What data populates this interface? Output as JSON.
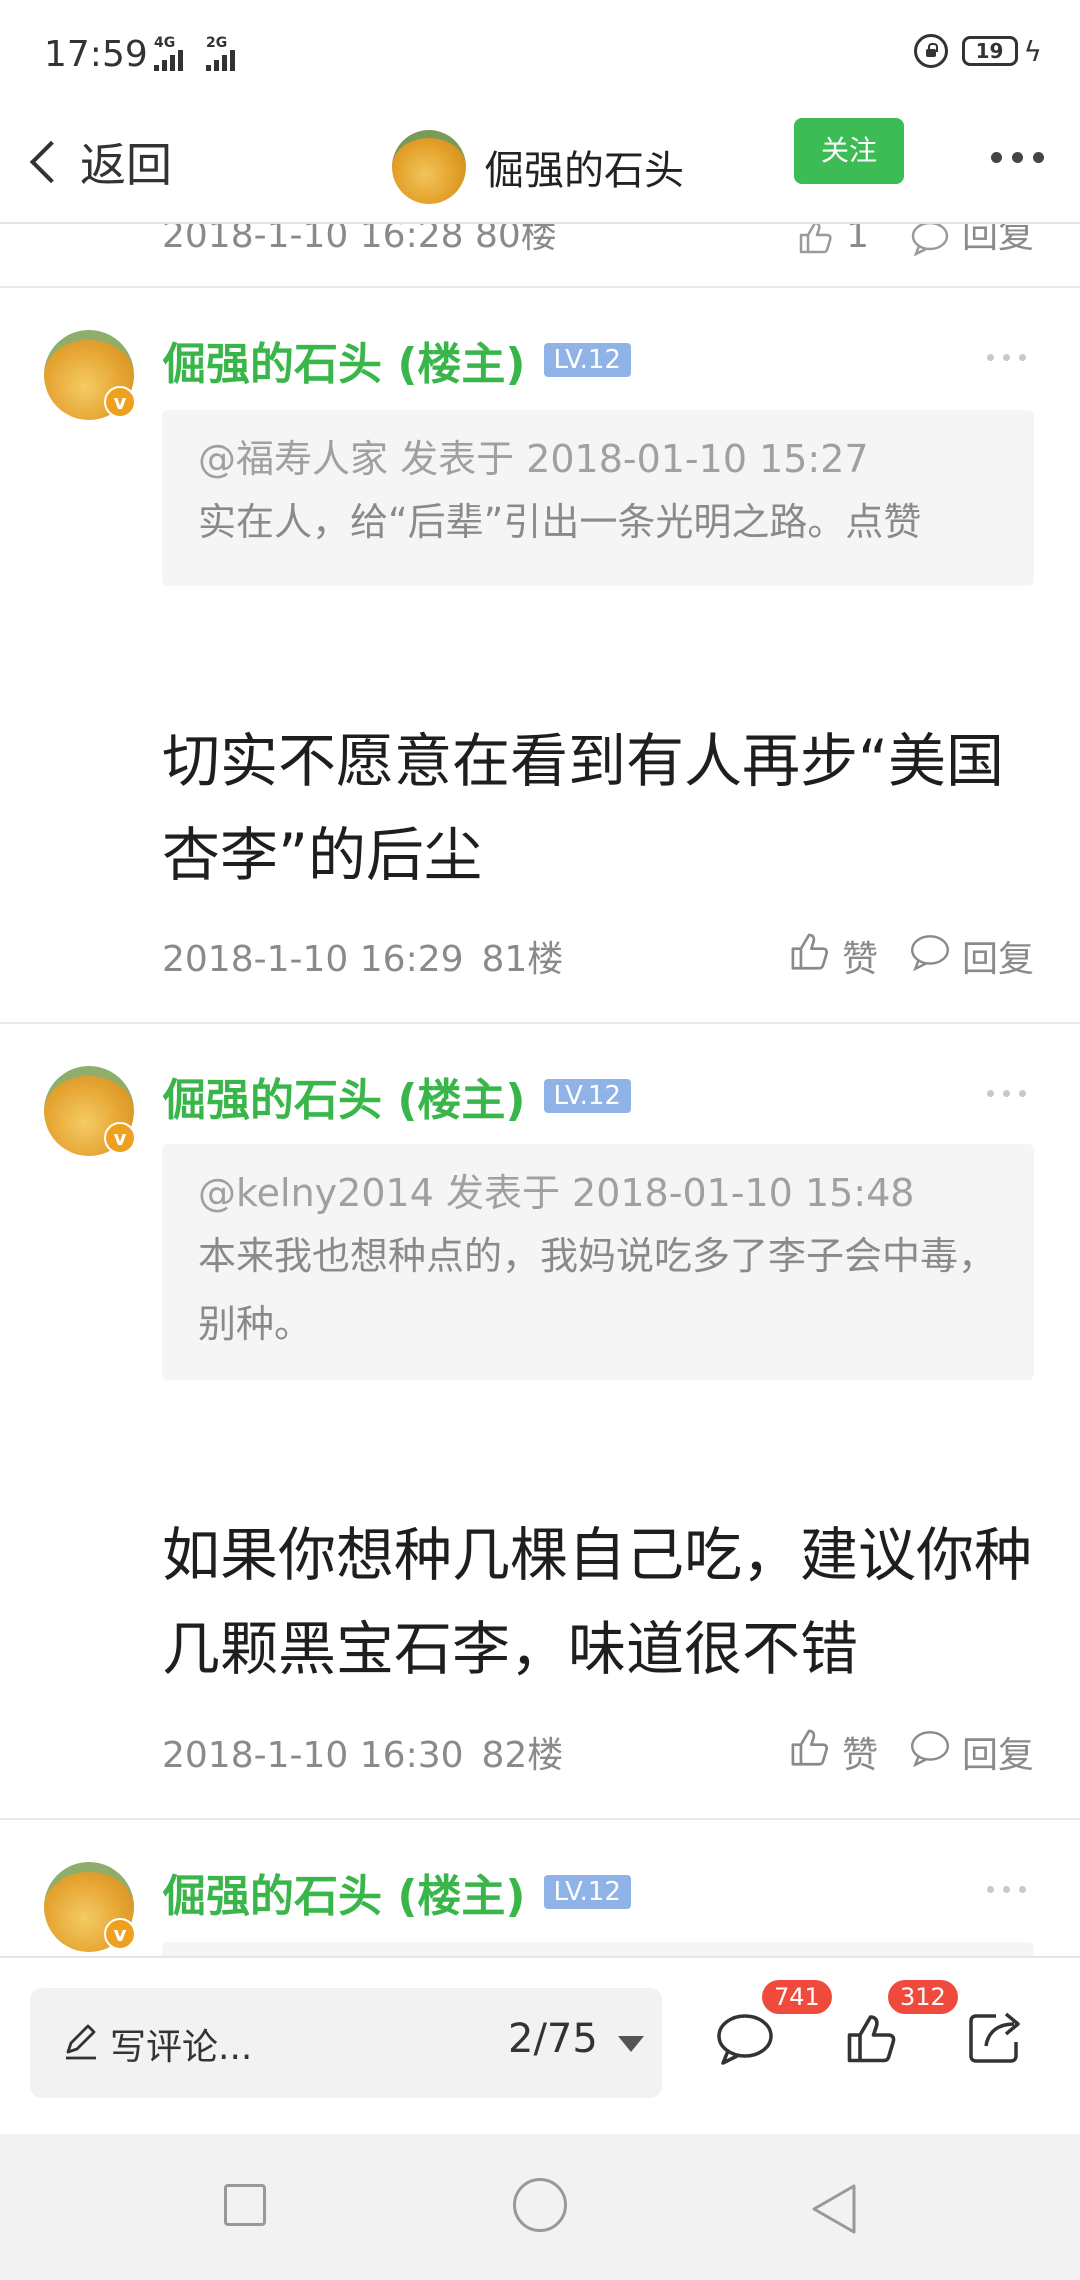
{
  "status_bar": {
    "time": "17:59",
    "network_1": "4G",
    "network_2": "2G",
    "battery": "19"
  },
  "nav": {
    "back_label": "返回",
    "title": "倔强的石头",
    "follow_label": "关注"
  },
  "partial_post": {
    "meta": "2018-1-10 16:28  80楼",
    "like_count": "1",
    "reply_label": "回复"
  },
  "posts": [
    {
      "author": "倔强的石头 (楼主)",
      "level": "LV.12",
      "quote_head": "@福寿人家 发表于 2018-01-10 15:27",
      "quote_text": "实在人，给“后辈”引出一条光明之路。点赞",
      "body": "切实不愿意在看到有人再步“美国杏李”的后尘",
      "date": "2018-1-10 16:29",
      "floor": "81楼",
      "like_label": "赞",
      "reply_label": "回复"
    },
    {
      "author": "倔强的石头 (楼主)",
      "level": "LV.12",
      "quote_head": "@kelny2014 发表于 2018-01-10 15:48",
      "quote_text": "本来我也想种点的，我妈说吃多了李子会中毒，别种。",
      "body": "如果你想种几棵自己吃，建议你种几颗黑宝石李，味道很不错",
      "date": "2018-1-10 16:30",
      "floor": "82楼",
      "like_label": "赞",
      "reply_label": "回复"
    },
    {
      "author": "倔强的石头 (楼主)",
      "level": "LV.12"
    }
  ],
  "bottom_bar": {
    "write_placeholder": "写评论...",
    "page_indicator": "2/75",
    "comment_count": "741",
    "like_count": "312"
  },
  "colors": {
    "accent_green": "#3dbb55",
    "author_green": "#3ab54a",
    "level_blue": "#8fb3e6",
    "badge_red": "#f04a3c"
  },
  "icons": [
    "back-chevron-icon",
    "lock-icon",
    "battery-icon",
    "more-icon",
    "thumb-up-icon",
    "comment-icon",
    "pencil-icon",
    "dropdown-arrow-icon",
    "share-icon"
  ]
}
